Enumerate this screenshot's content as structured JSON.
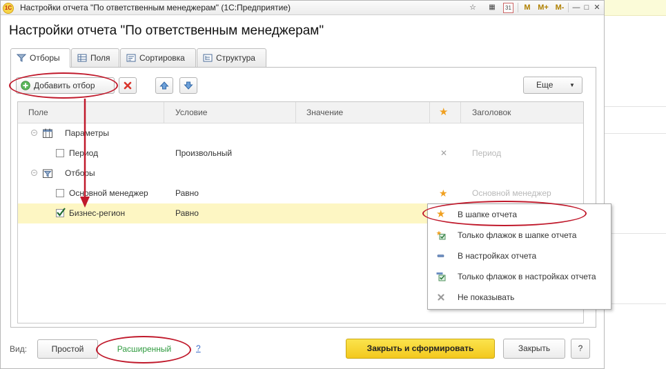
{
  "window": {
    "title": "Настройки отчета \"По ответственным менеджерам\"  (1С:Предприятие)",
    "logo_text": "1С",
    "toolbar": [
      "☆",
      "▦",
      "31",
      "M",
      "M+",
      "M-",
      "—",
      "□",
      "✕"
    ]
  },
  "form": {
    "title": "Настройки отчета \"По ответственным менеджерам\""
  },
  "tabs": [
    {
      "label": "Отборы",
      "icon": "filter-icon",
      "active": true
    },
    {
      "label": "Поля",
      "icon": "fields-icon"
    },
    {
      "label": "Сортировка",
      "icon": "sort-icon"
    },
    {
      "label": "Структура",
      "icon": "structure-icon"
    }
  ],
  "toolbar": {
    "add_filter_label": "Добавить отбор",
    "delete_icon": "delete-icon",
    "up_icon": "arrow-up-icon",
    "down_icon": "arrow-down-icon",
    "more_label": "Еще",
    "more_arrow": "▼"
  },
  "grid": {
    "columns": [
      "Поле",
      "Условие",
      "Значение",
      "★",
      "Заголовок"
    ],
    "rows": [
      {
        "type": "group",
        "label": "Параметры",
        "toggle": "⊖"
      },
      {
        "type": "item",
        "label": "Период",
        "checked": false,
        "condition": "Произвольный",
        "value": "",
        "mode": "✕",
        "caption": "Период"
      },
      {
        "type": "group",
        "label": "Отборы",
        "toggle": "⊖"
      },
      {
        "type": "item",
        "label": "Основной менеджер",
        "checked": false,
        "condition": "Равно",
        "value": "",
        "mode": "★",
        "caption": "Основной менеджер"
      },
      {
        "type": "item",
        "label": "Бизнес-регион",
        "checked": true,
        "condition": "Равно",
        "value": "",
        "mode": "",
        "caption": ""
      }
    ]
  },
  "popup": {
    "items": [
      {
        "label": "В шапке отчета",
        "icon": "star-icon"
      },
      {
        "label": "Только флажок в шапке отчета",
        "icon": "star-checkbox-icon"
      },
      {
        "label": "В настройках отчета",
        "icon": "dash-icon"
      },
      {
        "label": "Только флажок в настройках отчета",
        "icon": "checkbox-icon"
      },
      {
        "label": "Не показывать",
        "icon": "grey-x-icon"
      }
    ]
  },
  "footer": {
    "view_label": "Вид:",
    "simple_label": "Простой",
    "advanced_label": "Расширенный",
    "help_link": "?",
    "close_generate_label": "Закрыть и сформировать",
    "close_label": "Закрыть",
    "help_button": "?"
  },
  "colors": {
    "selected_row": "#fdf6c3",
    "primary_button": "#f6d32e",
    "highlight_oval": "#c0192b",
    "star": "#f0a020",
    "advanced_text": "#2e9a3e"
  }
}
